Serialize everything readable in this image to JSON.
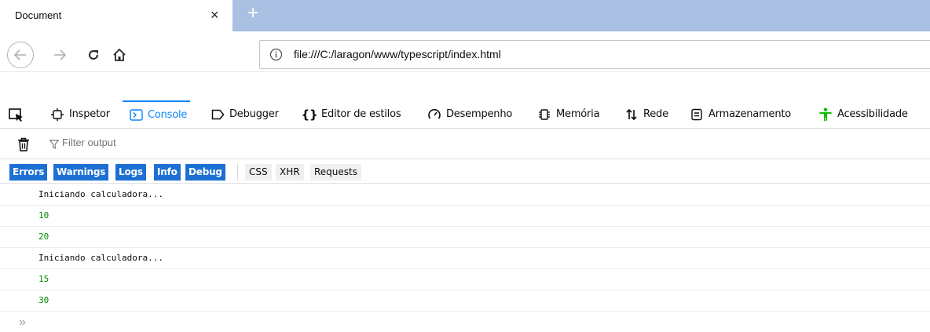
{
  "browser": {
    "tab_title": "Document",
    "tab_close": "×",
    "new_tab": "+",
    "url": "file:///C:/laragon/www/typescript/index.html"
  },
  "devtools": {
    "tabs": [
      {
        "label": "Inspetor",
        "icon": "inspector-icon"
      },
      {
        "label": "Console",
        "icon": "console-icon",
        "active": true
      },
      {
        "label": "Debugger",
        "icon": "debugger-icon"
      },
      {
        "label": "Editor de estilos",
        "icon": "style-editor-icon"
      },
      {
        "label": "Desempenho",
        "icon": "performance-icon"
      },
      {
        "label": "Memória",
        "icon": "memory-icon"
      },
      {
        "label": "Rede",
        "icon": "network-icon"
      },
      {
        "label": "Armazenamento",
        "icon": "storage-icon"
      },
      {
        "label": "Acessibilidade",
        "icon": "accessibility-icon"
      }
    ],
    "filter_placeholder": "Filter output",
    "levels": [
      "Errors",
      "Warnings",
      "Logs",
      "Info",
      "Debug"
    ],
    "categories": [
      "CSS",
      "XHR",
      "Requests"
    ],
    "messages": [
      {
        "text": "Iniciando calculadora...",
        "type": "string"
      },
      {
        "text": "10",
        "type": "number"
      },
      {
        "text": "20",
        "type": "number"
      },
      {
        "text": "Iniciando calculadora...",
        "type": "string"
      },
      {
        "text": "15",
        "type": "number"
      },
      {
        "text": "30",
        "type": "number"
      }
    ],
    "prompt": "»"
  },
  "colors": {
    "accent": "#0a84ff",
    "level_button": "#1c70d4",
    "number_output": "#058b00",
    "tabbar_bg": "#a9c0e2"
  }
}
